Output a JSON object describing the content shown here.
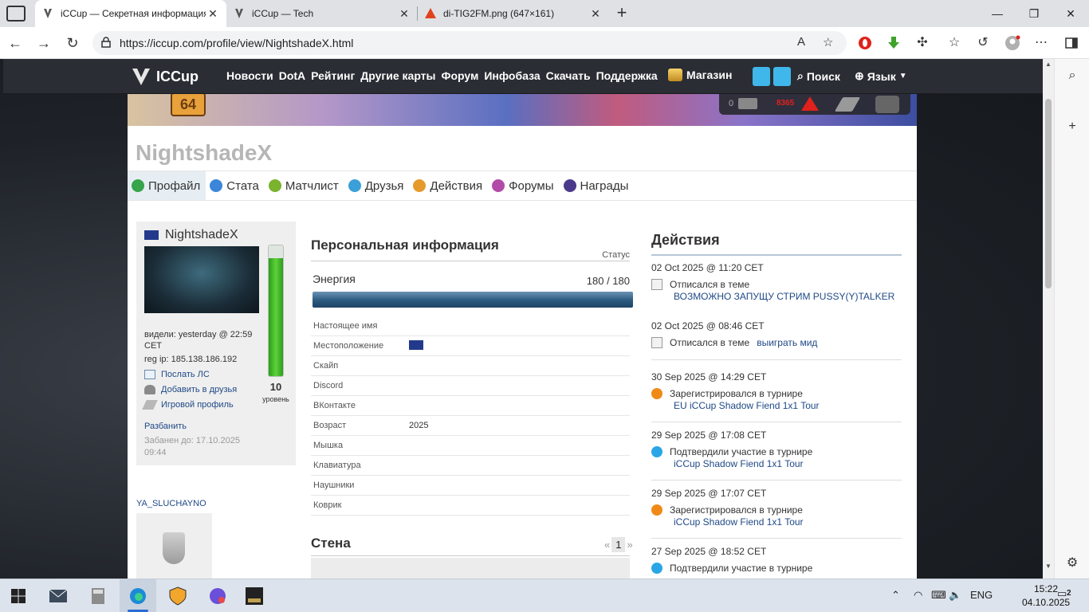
{
  "browser": {
    "tabs": [
      {
        "title": "iCCup — Секретная информация",
        "active": true
      },
      {
        "title": "iCCup — Tech",
        "active": false
      },
      {
        "title": "di-TIG2FM.png (647×161)",
        "active": false
      }
    ],
    "url": "https://iccup.com/profile/view/NightshadeX.html"
  },
  "site": {
    "logo": "ICCup",
    "nav": [
      "Новости",
      "DotA",
      "Рейтинг",
      "Другие карты",
      "Форум",
      "Инфобаза",
      "Скачать",
      "Поддержка"
    ],
    "shop": "Магазин",
    "search": "Поиск",
    "lang": "Язык"
  },
  "banner": {
    "level_badge": "64",
    "mail_count": "0",
    "alert_count": "8365"
  },
  "profile": {
    "name": "NightshadeX",
    "tabs": [
      "Профайл",
      "Стата",
      "Матчлист",
      "Друзья",
      "Действия",
      "Форумы",
      "Награды"
    ],
    "active_tab": "Профайл",
    "card": {
      "username": "NightshadeX",
      "seen": "видели: yesterday @ 22:59 CET",
      "reg_ip": "reg ip: 185.138.186.192",
      "send_pm": "Послать ЛС",
      "add_friend": "Добавить в друзья",
      "game_profile": "Игровой профиль",
      "unban": "Разбанить",
      "banned_until": "Забанен до: 17.10.2025 09:44",
      "level": "10",
      "level_label": "уровень",
      "energy_fill": 0.9
    },
    "friend_name": "YA_SLUCHAYNO"
  },
  "personal": {
    "title": "Персональная информация",
    "status_label": "Статус",
    "energy_label": "Энергия",
    "energy_value": "180 / 180",
    "energy_fill": 1.0,
    "rows": [
      {
        "key": "Настоящее имя",
        "value": ""
      },
      {
        "key": "Местоположение",
        "value": ""
      },
      {
        "key": "Скайп",
        "value": ""
      },
      {
        "key": "Discord",
        "value": ""
      },
      {
        "key": "ВКонтакте",
        "value": ""
      },
      {
        "key": "Возраст",
        "value": "2025"
      },
      {
        "key": "Мышка",
        "value": ""
      },
      {
        "key": "Клавиатура",
        "value": ""
      },
      {
        "key": "Наушники",
        "value": ""
      },
      {
        "key": "Коврик",
        "value": ""
      }
    ],
    "wall_title": "Стена",
    "wall_page": "1",
    "pager_prev": "«",
    "pager_next": "»"
  },
  "actions": {
    "title": "Действия",
    "items": [
      {
        "date": "02 Oct 2025 @ 11:20 CET",
        "text": "Отписался в теме",
        "link": "ВОЗМОЖНО ЗАПУЩУ СТРИМ PUSSY(Y)TALKER",
        "icon": "doc-icon"
      },
      {
        "date": "02 Oct 2025 @ 08:46 CET",
        "text": "Отписался в теме",
        "link": "выиграть мид",
        "icon": "doc-icon"
      },
      {
        "date": "30 Sep 2025 @ 14:29 CET",
        "text": "Зарегистрировался в турнире",
        "link": "EU iCCup Shadow Fiend 1x1 Tour",
        "icon": "register-icon"
      },
      {
        "date": "29 Sep 2025 @ 17:08 CET",
        "text": "Подтвердили участие в турнире",
        "link": "iCCup Shadow Fiend 1x1 Tour",
        "icon": "confirm-icon"
      },
      {
        "date": "29 Sep 2025 @ 17:07 CET",
        "text": "Зарегистрировался в турнире",
        "link": "iCCup Shadow Fiend 1x1 Tour",
        "icon": "register-icon"
      },
      {
        "date": "27 Sep 2025 @ 18:52 CET",
        "text": "Подтвердили участие в турнире",
        "link": "",
        "icon": "confirm-icon"
      }
    ]
  },
  "taskbar": {
    "lang": "ENG",
    "time": "15:22",
    "date": "04.10.2025",
    "notifications": "2"
  }
}
